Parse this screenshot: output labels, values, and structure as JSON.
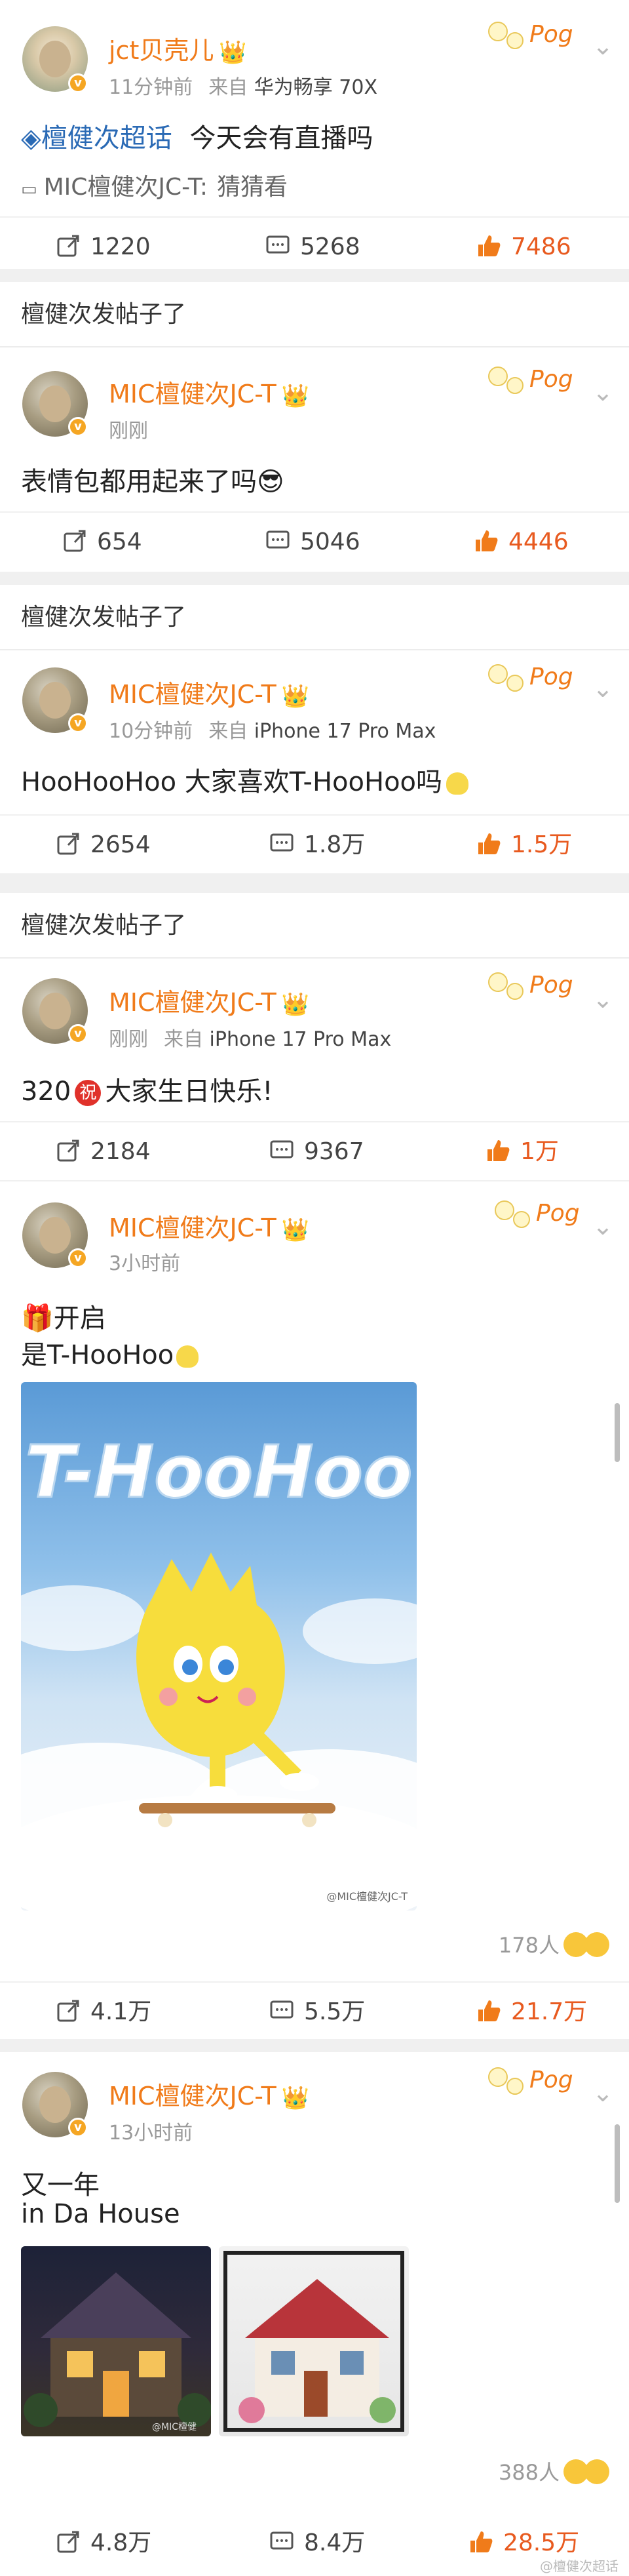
{
  "posts": [
    {
      "author": "jct贝壳儿",
      "time": "11分钟前",
      "source_prefix": "来自",
      "device": "华为畅享 70X",
      "topic_icon_name": "diamond-icon",
      "topic": "檀健次超话",
      "body": "今天会有直播吗",
      "reply_user": "MIC檀健次JC-T:",
      "reply_text": "猜猜看",
      "reposts": "1220",
      "comments": "5268",
      "likes": "7486"
    },
    {
      "group_title": "檀健次发帖子了",
      "author": "MIC檀健次JC-T",
      "time": "刚刚",
      "body": "表情包都用起来了吗😎",
      "reposts": "654",
      "comments": "5046",
      "likes": "4446"
    },
    {
      "group_title": "檀健次发帖子了",
      "author": "MIC檀健次JC-T",
      "time": "10分钟前",
      "source_prefix": "来自",
      "device": "iPhone 17 Pro Max",
      "body": "HooHooHoo 大家喜欢T-HooHoo吗",
      "reposts": "2654",
      "comments": "1.8万",
      "likes": "1.5万"
    },
    {
      "group_title": "檀健次发帖子了",
      "author": "MIC檀健次JC-T",
      "time": "刚刚",
      "source_prefix": "来自",
      "device": "iPhone 17 Pro Max",
      "body_pre": "320",
      "body_badge": "祝",
      "body_post": "大家生日快乐!",
      "reposts": "2184",
      "comments": "9367",
      "likes": "1万"
    },
    {
      "author": "MIC檀健次JC-T",
      "time": "3小时前",
      "body_line1": "🎁开启",
      "body_line2": "是T-HooHoo",
      "image_title": "T-HooHoo",
      "image_watermark": "@MIC檀健次JC-T",
      "reaction_count": "178人",
      "reposts": "4.1万",
      "comments": "5.5万",
      "likes": "21.7万"
    },
    {
      "author": "MIC檀健次JC-T",
      "time": "13小时前",
      "body_line1": "又一年",
      "body_line2": "in Da House",
      "image_watermark": "@MIC檀健",
      "reaction_count": "388人",
      "reposts": "4.8万",
      "comments": "8.4万",
      "likes": "28.5万"
    }
  ],
  "sticker_text": "Pog",
  "footer_watermark": "@檀健次超话",
  "colors": {
    "brand_orange": "#f07b1a",
    "like_red": "#e85a1f",
    "topic_blue": "#2a6ab5"
  }
}
